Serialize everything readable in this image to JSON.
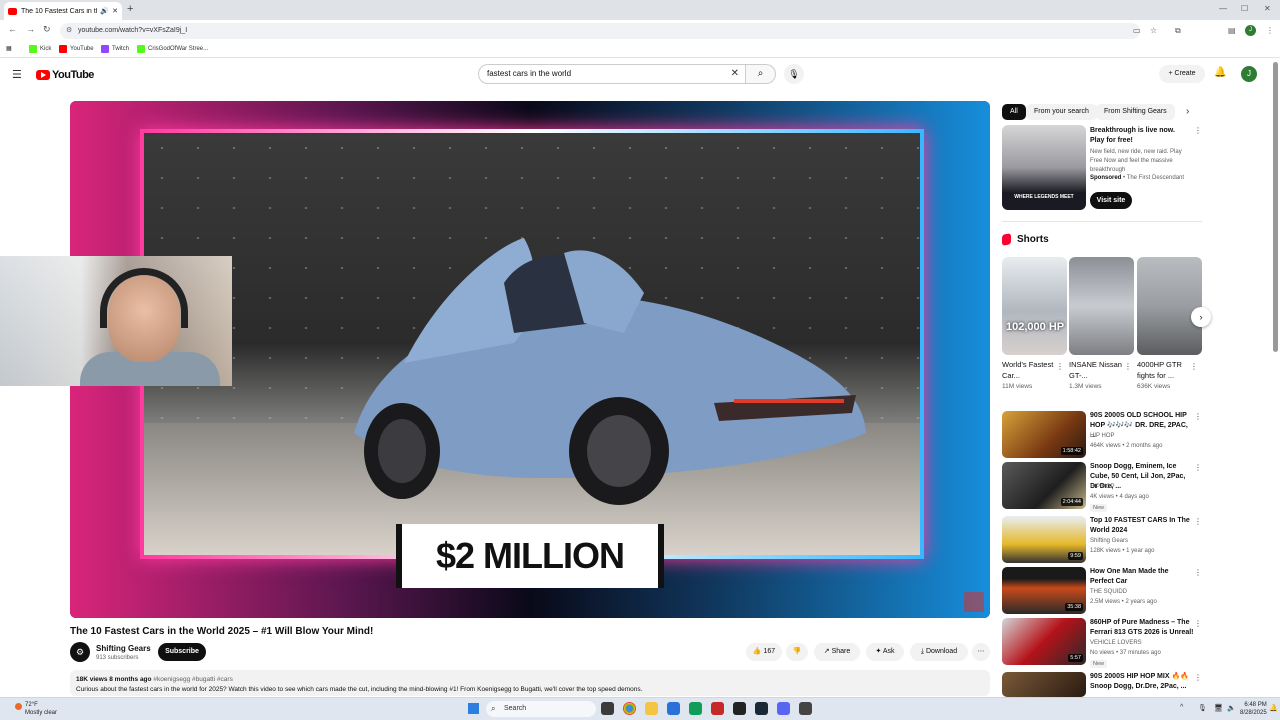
{
  "browser": {
    "tab_title": "The 10 Fastest Cars in the W",
    "url": "youtube.com/watch?v=vXFsZaI9j_I",
    "bookmarks": [
      {
        "label": "Kick",
        "color": "#53fc18"
      },
      {
        "label": "YouTube",
        "color": "#ff0000"
      },
      {
        "label": "Twitch",
        "color": "#9146ff"
      },
      {
        "label": "CrisGodOfWar Stree...",
        "color": "#53fc18"
      }
    ],
    "profile_initial": "J"
  },
  "yt_header": {
    "logo_text": "YouTube",
    "search_value": "fastest cars in the world",
    "create_label": "Create",
    "avatar_initial": "J"
  },
  "video": {
    "overlay_price": "$2 MILLION",
    "title": "The 10 Fastest Cars in the World 2025 – #1 Will Blow Your Mind!",
    "channel_name": "Shifting Gears",
    "subscribers": "913 subscribers",
    "subscribe_label": "Subscribe",
    "likes": "167",
    "share_label": "Share",
    "ask_label": "Ask",
    "download_label": "Download",
    "views": "18K views",
    "age": "8 months ago",
    "hashtags": "#koenigsegg #bugatti #cars",
    "description": "Curious about the fastest cars in the world for 2025? Watch this video to see which cars made the cut, including the mind-blowing #1! From Koenigsegg to Bugatti, we'll cover the top speed demons."
  },
  "sidebar": {
    "chips": [
      "All",
      "From your search",
      "From Shifting Gears"
    ],
    "ad": {
      "title": "Breakthrough is live now. Play for free!",
      "description": "New field, new ride, new raid. Play Free Now and feel the massive breakthrough",
      "sponsored_label": "Sponsored",
      "advertiser": "The First Descendant",
      "visit_label": "Visit site",
      "thumb_text": "WHERE LEGENDS MEET"
    },
    "shorts_label": "Shorts",
    "shorts": [
      {
        "title": "World's Fastest Car...",
        "views": "11M views",
        "thumb_text": "102,000 HP"
      },
      {
        "title": "INSANE Nissan GT-...",
        "views": "1.3M views",
        "thumb_text": ""
      },
      {
        "title": "4000HP GTR fights for ...",
        "views": "636K views",
        "thumb_text": ""
      }
    ],
    "recommendations": [
      {
        "title": "90S 2000S OLD SCHOOL HIP HOP 🎶🎶🎶 DR. DRE, 2PAC, ...",
        "channel": "HIP HOP",
        "meta": "464K views • 2 months ago",
        "duration": "1:58:42",
        "badge": ""
      },
      {
        "title": "Snoop Dogg, Eminem, Ice Cube, 50 Cent, Lil Jon, 2Pac, Dr Dre, ...",
        "channel": "HIP HOP",
        "meta": "4K views • 4 days ago",
        "duration": "2:04:44",
        "badge": "New"
      },
      {
        "title": "Top 10 FASTEST CARS In The World 2024",
        "channel": "Shifting Gears",
        "meta": "128K views • 1 year ago",
        "duration": "9:59",
        "badge": ""
      },
      {
        "title": "How One Man Made the Perfect Car",
        "channel": "THE SQUIDD",
        "meta": "2.5M views • 2 years ago",
        "duration": "35:38",
        "badge": ""
      },
      {
        "title": "860HP of Pure Madness – The Ferrari 813 GTS 2026 is Unreal!",
        "channel": "VEHICLE LOVERS",
        "meta": "No views • 37 minutes ago",
        "duration": "5:57",
        "badge": "New"
      },
      {
        "title": "90S 2000S HIP HOP MIX 🔥🔥 Snoop Dogg, Dr.Dre, 2Pac, ...",
        "channel": "",
        "meta": "",
        "duration": "",
        "badge": ""
      }
    ]
  },
  "taskbar": {
    "temp": "72°F",
    "weather": "Mostly clear",
    "search_label": "Search",
    "time": "6:48 PM",
    "date": "8/28/2025"
  }
}
